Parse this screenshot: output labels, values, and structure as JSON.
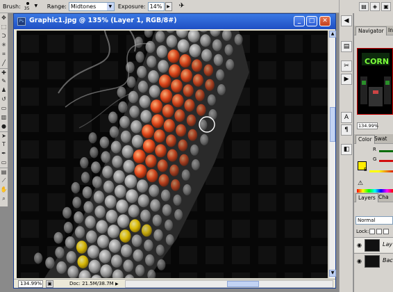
{
  "options_bar": {
    "brush_label": "Brush:",
    "brush_size": "35",
    "range_label": "Range:",
    "range_value": "Midtones",
    "exposure_label": "Exposure:",
    "exposure_value": "14%"
  },
  "document": {
    "title": "Graphic1.jpg @ 135% (Layer 1, RGB/8#)",
    "zoom": "134.99%",
    "doc_info": "Doc: 21.5M/38.7M"
  },
  "navigator": {
    "tabs": [
      "Navigator",
      "Inf"
    ],
    "zoom": "134.99%",
    "thumb_text": "CORN"
  },
  "color": {
    "tabs": [
      "Color",
      "Swat"
    ],
    "foreground": "#ffee00",
    "background": "#ffffff",
    "channels": [
      "R",
      "G",
      "B"
    ]
  },
  "layers": {
    "tabs": [
      "Layers",
      "Cha"
    ],
    "blend_mode": "Normal",
    "lock_label": "Lock:",
    "rows": [
      {
        "name": "Lay"
      },
      {
        "name": "Bac"
      }
    ]
  },
  "colors": {
    "titlebar": "#2456d1",
    "chrome": "#d6d3ce",
    "highlight_orange": "#e2461a",
    "highlight_yellow": "#f5d000"
  }
}
